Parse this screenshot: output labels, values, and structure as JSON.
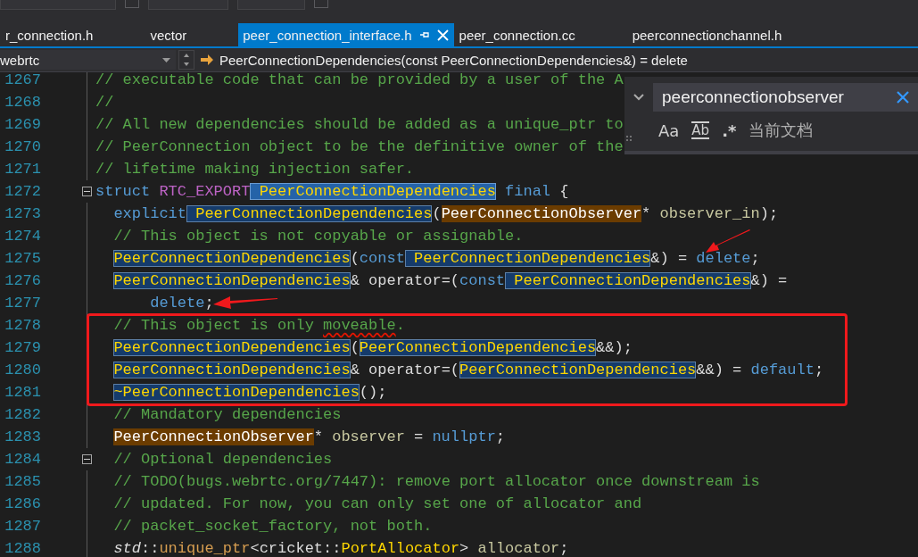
{
  "tabs": [
    {
      "label": "r_connection.h",
      "selected": false
    },
    {
      "label": "vector",
      "selected": false
    },
    {
      "label": "peer_connection_interface.h",
      "selected": true
    },
    {
      "label": "peer_connection.cc",
      "selected": false
    },
    {
      "label": "peerconnectionchannel.h",
      "selected": false
    }
  ],
  "nav_bar": {
    "scope": "webrtc",
    "member": "PeerConnectionDependencies(const PeerConnectionDependencies&) = delete"
  },
  "find_widget": {
    "value": "peerconnectionobserver",
    "options": [
      {
        "kind": "case",
        "label": "Aa"
      },
      {
        "kind": "word",
        "label": "Ab"
      },
      {
        "kind": "regex",
        "label": ".*"
      }
    ],
    "scope": "当前文档"
  },
  "code_lines": [
    {
      "number": "1267",
      "fold": false,
      "kind": "top",
      "tokens": [
        {
          "kind": "comment",
          "text": "// executable code that can be provided by a user of the A"
        }
      ]
    },
    {
      "number": "1268",
      "fold": false,
      "kind": "top",
      "tokens": [
        {
          "kind": "comment",
          "text": "//"
        }
      ]
    },
    {
      "number": "1269",
      "fold": false,
      "kind": "top",
      "tokens": [
        {
          "kind": "comment",
          "text": "// All new dependencies should be added as a unique_ptr to"
        }
      ]
    },
    {
      "number": "1270",
      "fold": false,
      "kind": "top",
      "tokens": [
        {
          "kind": "comment",
          "text": "// PeerConnection object to be the definitive owner of the"
        }
      ]
    },
    {
      "number": "1271",
      "fold": false,
      "kind": "top",
      "tokens": [
        {
          "kind": "comment",
          "text": "// lifetime making injection safer."
        }
      ]
    },
    {
      "number": "1272",
      "fold": true,
      "kind": "top",
      "tokens": [
        {
          "kind": "keyword",
          "text": "struct"
        },
        {
          "kind": "macro",
          "text": "RTC_EXPORT"
        },
        {
          "kind": "current",
          "text": "PeerConnectionDependencies"
        },
        {
          "kind": "keyword",
          "text": "final"
        },
        {
          "kind": "plain",
          "text": "{"
        }
      ]
    },
    {
      "number": "1273",
      "fold": false,
      "kind": "member",
      "tokens": [
        {
          "kind": "keyword",
          "text": "explicit"
        },
        {
          "kind": "match",
          "text": "PeerConnectionDependencies"
        },
        {
          "kind": "plain",
          "text": "(",
          "glued": true
        },
        {
          "kind": "found",
          "text": "PeerConnectionObserver",
          "glued": true
        },
        {
          "kind": "plain",
          "text": "*",
          "glued": true
        },
        {
          "kind": "param",
          "text": "observer_in"
        },
        {
          "kind": "plain",
          "text": ");",
          "glued": true
        }
      ]
    },
    {
      "number": "1274",
      "fold": false,
      "kind": "member",
      "tokens": [
        {
          "kind": "comment",
          "text": "// This object is not copyable or assignable."
        }
      ]
    },
    {
      "number": "1275",
      "fold": false,
      "kind": "member",
      "tokens": [
        {
          "kind": "match",
          "text": "PeerConnectionDependencies"
        },
        {
          "kind": "plain",
          "text": "(",
          "glued": true
        },
        {
          "kind": "keyword",
          "text": "const",
          "glued": true
        },
        {
          "kind": "match",
          "text": "PeerConnectionDependencies"
        },
        {
          "kind": "plain",
          "text": "&) =",
          "glued": true
        },
        {
          "kind": "keyword",
          "text": "delete"
        },
        {
          "kind": "plain",
          "text": ";",
          "glued": true
        }
      ]
    },
    {
      "number": "1276",
      "fold": false,
      "kind": "member",
      "tokens": [
        {
          "kind": "match",
          "text": "PeerConnectionDependencies"
        },
        {
          "kind": "plain",
          "text": "& operator=(",
          "glued": true
        },
        {
          "kind": "keyword",
          "text": "const",
          "glued": true
        },
        {
          "kind": "match",
          "text": "PeerConnectionDependencies"
        },
        {
          "kind": "plain",
          "text": "&) =",
          "glued": true
        }
      ]
    },
    {
      "number": "1277",
      "fold": false,
      "kind": "continuation",
      "tokens": [
        {
          "kind": "keyword",
          "text": "delete"
        },
        {
          "kind": "plain",
          "text": ";",
          "glued": true
        }
      ]
    },
    {
      "number": "1278",
      "fold": false,
      "kind": "member",
      "tokens": [
        {
          "kind": "comment",
          "text": "// This object is only"
        },
        {
          "kind": "comment",
          "text": "moveable",
          "squiggle": true
        },
        {
          "kind": "comment",
          "text": ".",
          "glued": true
        }
      ]
    },
    {
      "number": "1279",
      "fold": false,
      "kind": "member",
      "tokens": [
        {
          "kind": "match",
          "text": "PeerConnectionDependencies"
        },
        {
          "kind": "plain",
          "text": "(",
          "glued": true
        },
        {
          "kind": "match",
          "text": "PeerConnectionDependencies",
          "glued": true
        },
        {
          "kind": "plain",
          "text": "&&);",
          "glued": true
        }
      ]
    },
    {
      "number": "1280",
      "fold": false,
      "kind": "member",
      "tokens": [
        {
          "kind": "match",
          "text": "PeerConnectionDependencies"
        },
        {
          "kind": "plain",
          "text": "& operator=(",
          "glued": true
        },
        {
          "kind": "match",
          "text": "PeerConnectionDependencies",
          "glued": true
        },
        {
          "kind": "plain",
          "text": "&&) =",
          "glued": true
        },
        {
          "kind": "keyword",
          "text": "default"
        },
        {
          "kind": "plain",
          "text": ";",
          "glued": true
        }
      ]
    },
    {
      "number": "1281",
      "fold": false,
      "kind": "member",
      "tokens": [
        {
          "kind": "match",
          "text": "~PeerConnectionDependencies"
        },
        {
          "kind": "plain",
          "text": "();",
          "glued": true
        }
      ]
    },
    {
      "number": "1282",
      "fold": false,
      "kind": "member",
      "tokens": [
        {
          "kind": "comment",
          "text": "// Mandatory dependencies"
        }
      ]
    },
    {
      "number": "1283",
      "fold": false,
      "kind": "member",
      "tokens": [
        {
          "kind": "found",
          "text": "PeerConnectionObserver"
        },
        {
          "kind": "plain",
          "text": "*",
          "glued": true
        },
        {
          "kind": "param",
          "text": "observer"
        },
        {
          "kind": "plain",
          "text": "="
        },
        {
          "kind": "keyword",
          "text": "nullptr"
        },
        {
          "kind": "plain",
          "text": ";",
          "glued": true
        }
      ]
    },
    {
      "number": "1284",
      "fold": true,
      "kind": "member",
      "tokens": [
        {
          "kind": "comment",
          "text": "// Optional dependencies"
        }
      ]
    },
    {
      "number": "1285",
      "fold": false,
      "kind": "member",
      "tokens": [
        {
          "kind": "comment",
          "text": "// TODO(bugs.webrtc.org/7447): remove port allocator once downstream is"
        }
      ]
    },
    {
      "number": "1286",
      "fold": false,
      "kind": "member",
      "tokens": [
        {
          "kind": "comment",
          "text": "// updated. For now, you can only set one of allocator and"
        }
      ]
    },
    {
      "number": "1287",
      "fold": false,
      "kind": "member",
      "tokens": [
        {
          "kind": "comment",
          "text": "// packet_socket_factory, not both."
        }
      ]
    },
    {
      "number": "1288",
      "fold": false,
      "kind": "member",
      "tokens": [
        {
          "kind": "namespace",
          "text": "std"
        },
        {
          "kind": "plain",
          "text": "::",
          "glued": true
        },
        {
          "kind": "template",
          "text": "unique_ptr",
          "glued": true
        },
        {
          "kind": "plain",
          "text": "<cricket::",
          "glued": true
        },
        {
          "kind": "class",
          "text": "PortAllocator",
          "glued": true
        },
        {
          "kind": "plain",
          "text": ">",
          "glued": true
        },
        {
          "kind": "param",
          "text": "allocator"
        },
        {
          "kind": "plain",
          "text": ";",
          "glued": true
        }
      ]
    }
  ]
}
